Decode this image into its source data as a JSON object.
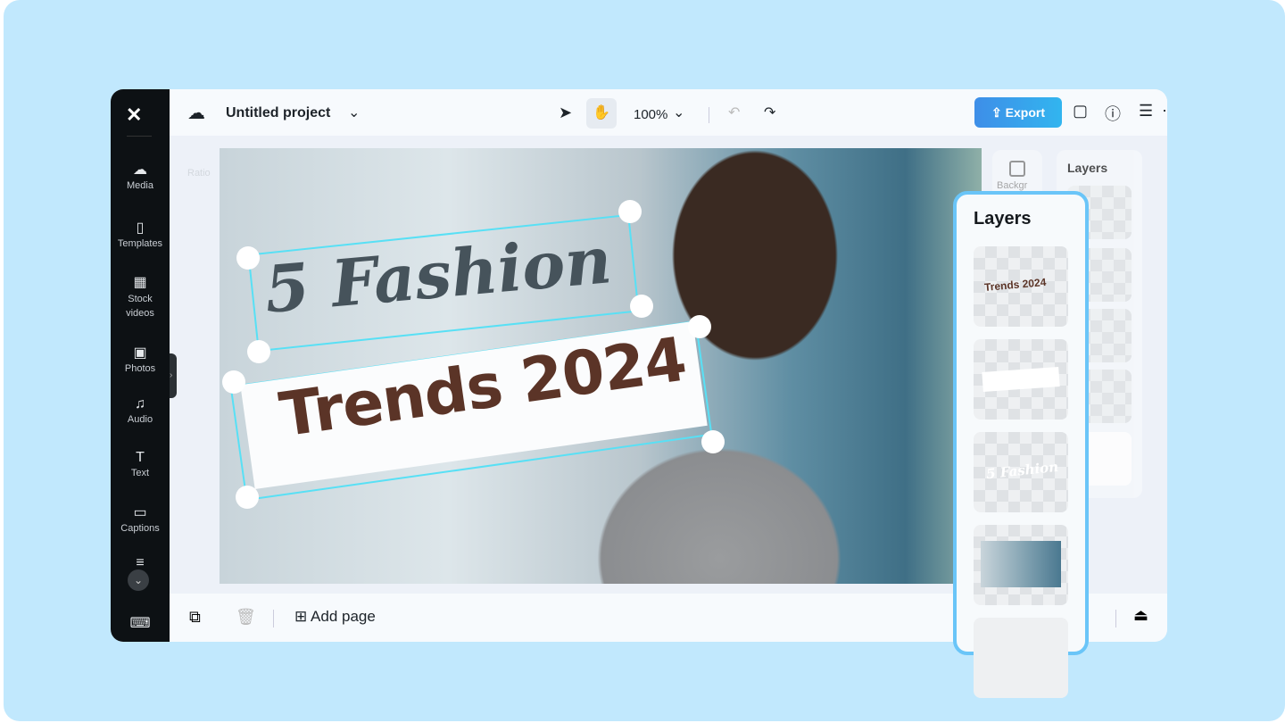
{
  "sidebar": {
    "logo": "CapCut",
    "items": [
      {
        "label": "Media",
        "icon": "cloud-upload-icon"
      },
      {
        "label": "Templates",
        "icon": "templates-icon"
      },
      {
        "label": "Stock videos",
        "icon": "film-icon"
      },
      {
        "label": "Photos",
        "icon": "image-icon"
      },
      {
        "label": "Audio",
        "icon": "music-icon"
      },
      {
        "label": "Text",
        "icon": "text-icon"
      },
      {
        "label": "Captions",
        "icon": "captions-icon"
      }
    ]
  },
  "header": {
    "project_title": "Untitled project",
    "zoom": "100%",
    "export_label": "Export",
    "accent": "#3e8ee8"
  },
  "toolbar": {
    "ratio_label": "Ratio"
  },
  "canvas": {
    "line1": "5 Fashion",
    "line2": "Trends 2024"
  },
  "right_panel": {
    "background_label": "Backgr",
    "layers_title": "Layers"
  },
  "layers_popup": {
    "title": "Layers",
    "items": [
      {
        "label": "Trends 2024"
      },
      {
        "label": ""
      },
      {
        "label": "5 Fashion"
      },
      {
        "label": ""
      }
    ]
  },
  "bottom": {
    "add_page_label": "Add page"
  }
}
